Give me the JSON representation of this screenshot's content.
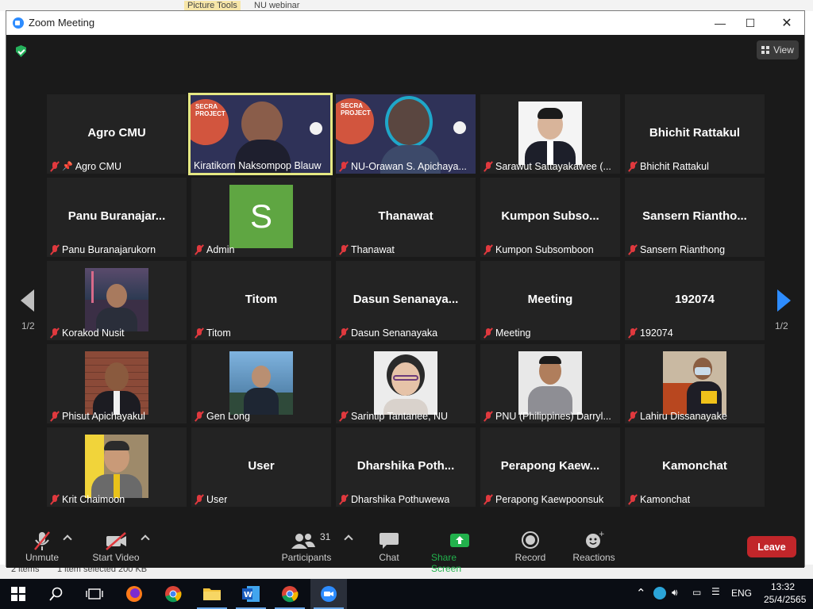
{
  "background_app": {
    "tabs": [
      "Picture Tools",
      "NU webinar"
    ],
    "status_items": "2 items",
    "status_selected": "1 item selected  200 KB"
  },
  "window": {
    "title": "Zoom Meeting",
    "minimize": "—",
    "maximize": "☐",
    "close": "✕"
  },
  "view_button": "View",
  "pagination": {
    "left": "1/2",
    "right": "1/2"
  },
  "tiles": [
    {
      "center": "Agro CMU",
      "label": "Agro CMU",
      "pinned": true
    },
    {
      "center": "",
      "label": "Kiratikorn Naksompop Blauw",
      "video": true,
      "active": true
    },
    {
      "center": "",
      "label": "NU-Orawan S. Apichaya...",
      "video": true
    },
    {
      "center": "",
      "label": "Sarawut Sattayakawee (...",
      "photo": true
    },
    {
      "center": "Bhichit Rattakul",
      "label": "Bhichit Rattakul"
    },
    {
      "center": "Panu Buranajar...",
      "label": "Panu Buranajarukorn"
    },
    {
      "center": "",
      "label": "Admin",
      "avatar": "S"
    },
    {
      "center": "Thanawat",
      "label": "Thanawat"
    },
    {
      "center": "Kumpon Subso...",
      "label": "Kumpon Subsomboon"
    },
    {
      "center": "Sansern Riantho...",
      "label": "Sansern Rianthong"
    },
    {
      "center": "",
      "label": "Korakod Nusit",
      "photo": true
    },
    {
      "center": "Titom",
      "label": "Titom"
    },
    {
      "center": "Dasun Senanaya...",
      "label": "Dasun Senanayaka"
    },
    {
      "center": "Meeting",
      "label": "Meeting"
    },
    {
      "center": "192074",
      "label": "192074"
    },
    {
      "center": "",
      "label": "Phisut Apichayakul",
      "photo": true
    },
    {
      "center": "",
      "label": "Gen Long",
      "photo": true
    },
    {
      "center": "",
      "label": "Sarintip Tantanee, NU",
      "photo": true
    },
    {
      "center": "",
      "label": "PNU (Philippines) Darryl...",
      "photo": true
    },
    {
      "center": "",
      "label": "Lahiru Dissanayake",
      "photo": true
    },
    {
      "center": "",
      "label": "Krit Chaimoon",
      "photo": true
    },
    {
      "center": "User",
      "label": "User"
    },
    {
      "center": "Dharshika Poth...",
      "label": "Dharshika Pothuwewa"
    },
    {
      "center": "Perapong Kaew...",
      "label": "Perapong Kaewpoonsuk"
    },
    {
      "center": "Kamonchat",
      "label": "Kamonchat"
    }
  ],
  "video_overlay": {
    "line1": "SECRA",
    "line2": "PROJECT"
  },
  "toolbar": {
    "unmute": "Unmute",
    "start_video": "Start Video",
    "participants": "Participants",
    "participant_count": "31",
    "chat": "Chat",
    "share_screen": "Share Screen",
    "record": "Record",
    "reactions": "Reactions",
    "leave": "Leave"
  },
  "taskbar": {
    "language": "ENG",
    "time": "13:32",
    "date": "25/4/2565"
  },
  "colors": {
    "active_speaker_border": "#e5e883",
    "share_green": "#22b14c",
    "leave_red": "#c1262a",
    "zoom_blue": "#2d8cff",
    "muted_red": "#e0393e"
  }
}
